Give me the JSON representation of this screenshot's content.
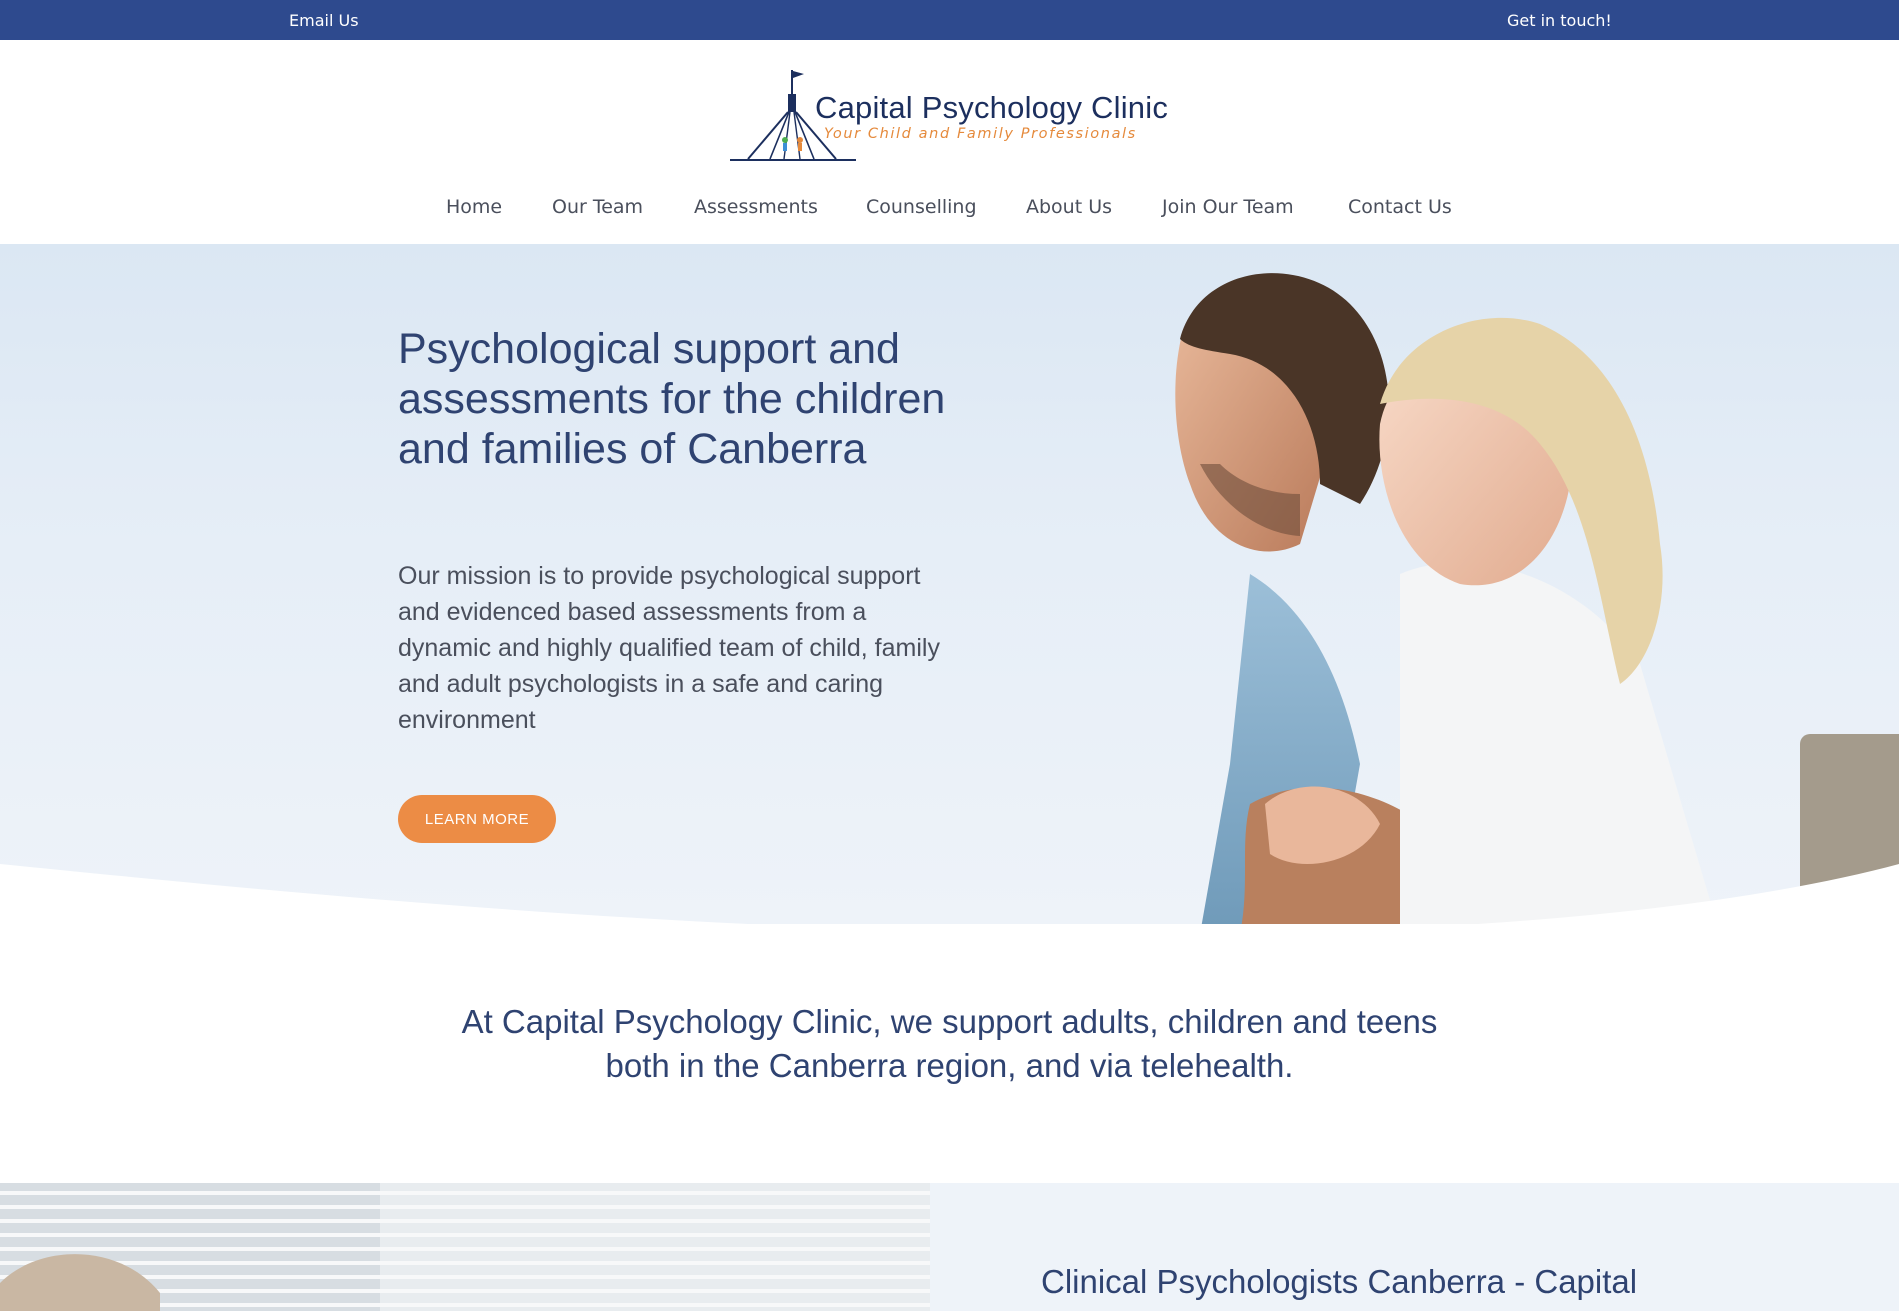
{
  "topbar": {
    "email_label": "Email Us",
    "contact_label": "Get in touch!",
    "background": "#2e4a8e"
  },
  "logo": {
    "name": "Capital Psychology Clinic",
    "tagline": "Your Child and Family Professionals",
    "icon": "parliament-flagpole-icon"
  },
  "nav": {
    "items": [
      {
        "label": "Home"
      },
      {
        "label": "Our Team"
      },
      {
        "label": "Assessments"
      },
      {
        "label": "Counselling"
      },
      {
        "label": "About Us"
      },
      {
        "label": "Join Our Team"
      },
      {
        "label": "Contact Us"
      }
    ]
  },
  "hero": {
    "heading": "Psychological support and assessments for the children and families of Canberra",
    "body": "Our mission is to provide psychological support and evidenced based assessments from a dynamic and highly qualified team of child, family and adult psychologists in a safe and caring environment",
    "cta_label": "LEARN MORE",
    "cta_color": "#ec8c45"
  },
  "statement": {
    "line1": "At Capital Psychology Clinic, we support adults, children and teens",
    "line2": "both in the Canberra region, and via telehealth."
  },
  "section2": {
    "heading": "Clinical Psychologists Canberra - Capital"
  },
  "colors": {
    "primary_text": "#2f4371",
    "accent": "#ec8c45",
    "topbar": "#2e4a8e"
  }
}
